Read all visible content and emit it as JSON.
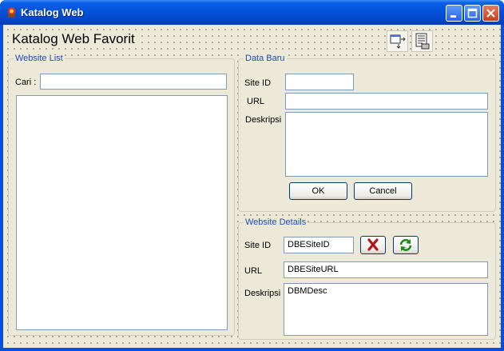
{
  "window": {
    "title": "Katalog Web"
  },
  "app": {
    "title": "Katalog Web Favorit"
  },
  "icons": {
    "app": "app-logo-icon",
    "minimize": "minimize-icon",
    "maximize": "maximize-icon",
    "close": "close-icon",
    "tool1": "form-layout-icon",
    "tool2": "report-icon",
    "delete": "delete-x-icon",
    "refresh": "refresh-icon"
  },
  "website_list": {
    "legend": "Website List",
    "search_label": "Cari :",
    "search_value": ""
  },
  "data_baru": {
    "legend": "Data Baru",
    "site_id_label": "Site ID",
    "url_label": "URL",
    "desc_label": "Deskripsi",
    "ok_label": "OK",
    "cancel_label": "Cancel"
  },
  "website_details": {
    "legend": "Website Details",
    "site_id_label": "Site ID",
    "site_id_value": "DBESiteID",
    "url_label": "URL",
    "url_value": "DBESiteURL",
    "desc_label": "Deskripsi",
    "desc_value": "DBMDesc"
  },
  "colors": {
    "accent": "#1f4bb8",
    "titlebar": "#0350d8",
    "face": "#ece9d8"
  }
}
